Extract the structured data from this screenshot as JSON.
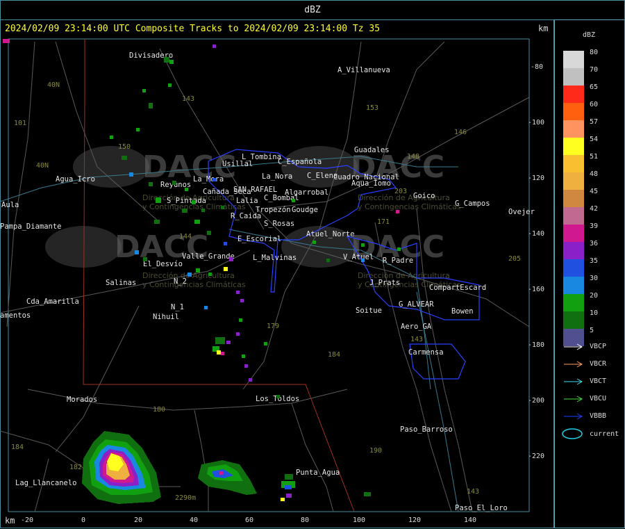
{
  "top_title": "dBZ",
  "header": {
    "text": "2024/02/09 23:14:00 UTC Composite Tracks to 2024/02/09 23:14:00 Tz 35",
    "km_top": "km",
    "km_bottom": "km"
  },
  "axes": {
    "x_ticks": [
      "-20",
      "0",
      "20",
      "40",
      "60",
      "80",
      "100",
      "120",
      "140"
    ],
    "y_ticks": [
      "-80",
      "-100",
      "-120",
      "-140",
      "-160",
      "-180",
      "-200",
      "-220"
    ]
  },
  "places": [
    "Divisadero",
    "A_Villanueva",
    "Guadales",
    "L_Tombina",
    "Usillal",
    "C_Española",
    "C_Elena",
    "La_Nora",
    "Cuadro_Nacional",
    "Aqua_Iomo",
    "Goico",
    "G_Campos",
    "Ovejer",
    "Agua_Icro",
    "Reyunos",
    "La_Mora",
    "Cañada_Seca",
    "SAN_RAFAEL",
    "Algarrobal",
    "Lalia",
    "C_Bombal",
    "Aula",
    "S_Pintada",
    "Tropezón",
    "Goudge",
    "R_Caida",
    "S_Rosas",
    "Pampa_Diamante",
    "Atuel_Norte",
    "E_Escorial",
    "L_Malvinas",
    "Valle_Grande",
    "V_Atuel",
    "R_Padre",
    "El_Desvío",
    "J_Prats",
    "CompartEscard",
    "Salinas",
    "N_2",
    "Cda_Amarilla",
    "G_ALVEAR",
    "N_1",
    "Soitue",
    "Bowen",
    "Nihuil",
    "amentos",
    "Aero_GA",
    "Carmensa",
    "Morados",
    "Los_Toldos",
    "Paso_Barroso",
    "Punta_Agua",
    "Lag_Llancanelo",
    "Paso_El_Loro"
  ],
  "road_numbers": [
    "40N",
    "101",
    "143",
    "153",
    "146",
    "148",
    "150",
    "203",
    "171",
    "144",
    "205",
    "180",
    "179",
    "184",
    "190",
    "143",
    "184",
    "182",
    "2290m",
    "143",
    "40N"
  ],
  "watermark": {
    "brand": "DACC",
    "line1": "Dirección de Agricultura",
    "line2": "y Contingencias Climáticas",
    "url": "http://www.contingencias.mendoza.gov.ar"
  },
  "legend": {
    "title": "dBZ",
    "levels": [
      {
        "label": "80",
        "color": "#d8d8d8"
      },
      {
        "label": "70",
        "color": "#c0c0c0"
      },
      {
        "label": "65",
        "color": "#ff2a1a"
      },
      {
        "label": "60",
        "color": "#ff6010"
      },
      {
        "label": "57",
        "color": "#ff9460"
      },
      {
        "label": "54",
        "color": "#ffff20"
      },
      {
        "label": "51",
        "color": "#f8c030"
      },
      {
        "label": "48",
        "color": "#f0b040"
      },
      {
        "label": "45",
        "color": "#d08840"
      },
      {
        "label": "42",
        "color": "#c06a90"
      },
      {
        "label": "39",
        "color": "#d01890"
      },
      {
        "label": "36",
        "color": "#8a20c8"
      },
      {
        "label": "35",
        "color": "#2050e0"
      },
      {
        "label": "30",
        "color": "#1888e0"
      },
      {
        "label": "20",
        "color": "#10a010"
      },
      {
        "label": "10",
        "color": "#107010"
      },
      {
        "label": "5",
        "color": "#505090"
      }
    ],
    "tracks": [
      {
        "label": "VBCP",
        "color": "#ffffff"
      },
      {
        "label": "VBCR",
        "color": "#ffa060"
      },
      {
        "label": "VBCT",
        "color": "#40e0f0"
      },
      {
        "label": "VBCU",
        "color": "#40e040"
      },
      {
        "label": "VBBB",
        "color": "#2040ff"
      }
    ],
    "current_label": "current",
    "current_color": "#20d0e0"
  }
}
